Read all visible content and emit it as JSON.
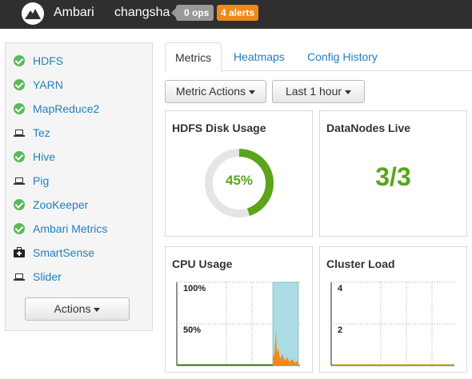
{
  "header": {
    "brand": "Ambari",
    "cluster_name": "changsha",
    "ops_badge": "0 ops",
    "alerts_badge": "4 alerts"
  },
  "sidebar": {
    "services": [
      {
        "label": "HDFS",
        "icon": "check-circle-icon"
      },
      {
        "label": "YARN",
        "icon": "check-circle-icon"
      },
      {
        "label": "MapReduce2",
        "icon": "check-circle-icon"
      },
      {
        "label": "Tez",
        "icon": "laptop-icon"
      },
      {
        "label": "Hive",
        "icon": "check-circle-icon"
      },
      {
        "label": "Pig",
        "icon": "laptop-icon"
      },
      {
        "label": "ZooKeeper",
        "icon": "check-circle-icon"
      },
      {
        "label": "Ambari Metrics",
        "icon": "check-circle-icon"
      },
      {
        "label": "SmartSense",
        "icon": "medkit-icon"
      },
      {
        "label": "Slider",
        "icon": "laptop-icon"
      }
    ],
    "actions_label": "Actions"
  },
  "tabs": [
    {
      "label": "Metrics",
      "active": true
    },
    {
      "label": "Heatmaps",
      "active": false
    },
    {
      "label": "Config History",
      "active": false
    }
  ],
  "toolbar": {
    "metric_actions_label": "Metric Actions",
    "time_range_label": "Last 1 hour"
  },
  "widgets": {
    "hdfs_disk_usage": {
      "title": "HDFS Disk Usage",
      "value_label": "45%",
      "percent": 45
    },
    "datanodes_live": {
      "title": "DataNodes Live",
      "value": "3/3"
    },
    "cpu_usage": {
      "title": "CPU Usage",
      "y_ticks": [
        "100%",
        "50%"
      ]
    },
    "cluster_load": {
      "title": "Cluster Load",
      "y_ticks": [
        "4",
        "2"
      ]
    }
  },
  "colors": {
    "accent_green": "#5aa51a",
    "link_blue": "#1f7fc1",
    "alert_orange": "#ee8a1c",
    "cpu_fill_cyan": "#a9dde3",
    "cpu_fill_orange": "#f08a1c",
    "load_line_yellow": "#e8c84a"
  }
}
